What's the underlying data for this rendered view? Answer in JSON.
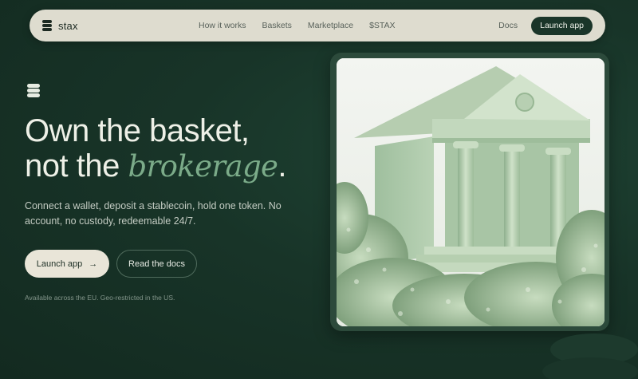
{
  "nav": {
    "brand": "stax",
    "links": [
      "How it works",
      "Baskets",
      "Marketplace",
      "$STAX"
    ],
    "docs": "Docs",
    "launch": "Launch app"
  },
  "hero": {
    "headline_line1": "Own the basket,",
    "headline_line2_pre": "not the ",
    "headline_accent": "brokerage",
    "headline_line2_post": ".",
    "subtext": "Connect a wallet, deposit a stablecoin, hold one token. No account, no custody, redeemable 24/7.",
    "primary_cta": "Launch app",
    "primary_arrow": "→",
    "secondary_cta": "Read the docs",
    "availability": "Available across the EU. Geo-restricted in the US."
  },
  "icons": {
    "brand_logo": "stacked-layers-icon",
    "hero_mark": "stacked-layers-icon",
    "cta_arrow": "arrow-right-icon"
  },
  "colors": {
    "background": "#173126",
    "nav_bg": "#dedccf",
    "accent_green": "#7bab89",
    "primary_button": "#e9e5d8",
    "dark_button": "#1a3529"
  }
}
